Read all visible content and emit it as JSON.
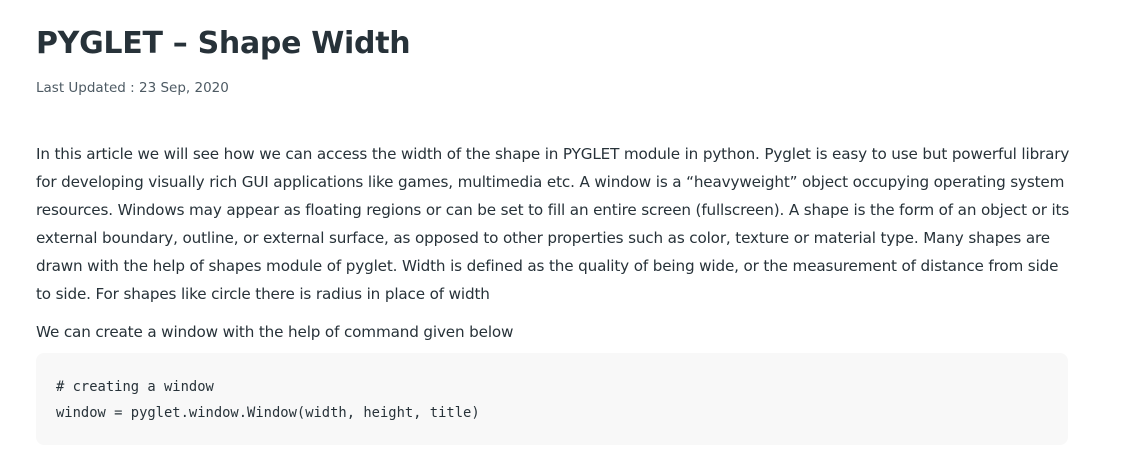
{
  "article": {
    "title": "PYGLET – Shape Width",
    "last_updated": "Last Updated : 23 Sep, 2020",
    "paragraphs": [
      "In this article we will see how we can access the width of the shape in PYGLET module in python. Pyglet is easy to use but powerful library for developing visually rich GUI applications like games, multimedia etc. A window is a “heavyweight” object occupying operating system resources. Windows may appear as floating regions or can be set to fill an entire screen (fullscreen). A shape is the form of an object or its external boundary, outline, or external surface, as opposed to other properties such as color, texture or material type. Many shapes are drawn with the help of shapes module of pyglet. Width is defined as the quality of being wide, or the measurement of distance from side to side. For shapes like circle there is radius in place of width",
      "We can create a window with the help of command given below"
    ],
    "code": {
      "lines": [
        "# creating a window",
        "window = pyglet.window.Window(width, height, title)"
      ]
    }
  },
  "colors": {
    "text": "#273239",
    "meta_text": "#4d5a63",
    "code_background": "#f8f8f8"
  }
}
